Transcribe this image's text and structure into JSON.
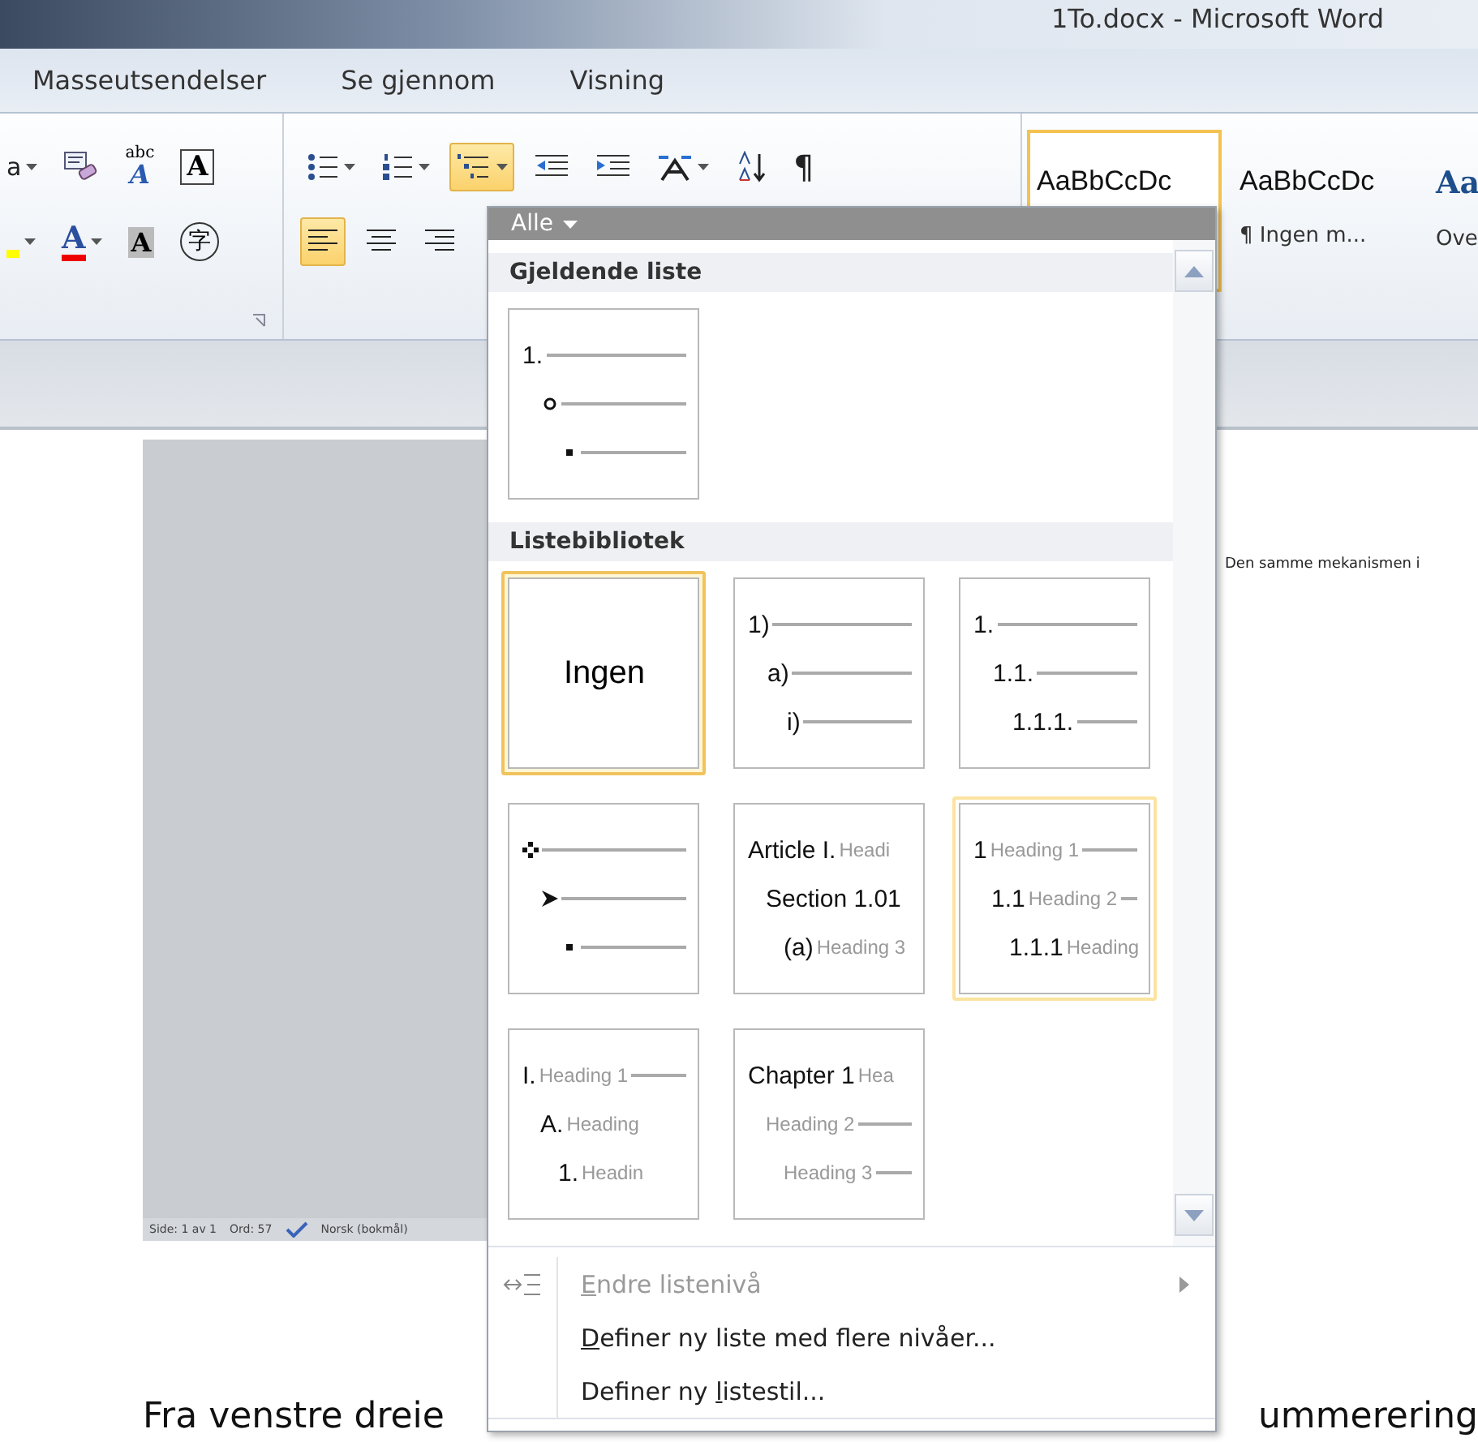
{
  "window": {
    "title": "1To.docx - Microsoft Word"
  },
  "tabs": [
    {
      "label": "Masseutsendelser",
      "selected": false
    },
    {
      "label": "Se gjennom",
      "selected": false
    },
    {
      "label": "Visning",
      "selected": false
    }
  ],
  "ribbon": {
    "font_row1": [
      {
        "kind": "text",
        "text": "a",
        "caret": true,
        "selected": false
      },
      {
        "kind": "eraser",
        "caret": false,
        "selected": false
      },
      {
        "kind": "phonetic",
        "text": "abc",
        "sub": "A",
        "caret": false,
        "selected": false
      },
      {
        "kind": "boxed",
        "text": "A",
        "caret": false,
        "selected": false
      }
    ],
    "font_row2": [
      {
        "kind": "highlight",
        "caret": true,
        "selected": false
      },
      {
        "kind": "fontcolor",
        "text": "A",
        "caret": true,
        "selected": false
      },
      {
        "kind": "shaded",
        "text": "A",
        "caret": false,
        "selected": false
      },
      {
        "kind": "enclosed",
        "text": "字",
        "caret": false,
        "selected": false
      }
    ],
    "para_row1": [
      {
        "kind": "bullets",
        "caret": true,
        "selected": false
      },
      {
        "kind": "numbering",
        "caret": true,
        "selected": false
      },
      {
        "kind": "multilevel",
        "caret": true,
        "selected": true
      },
      {
        "kind": "outdent",
        "caret": false,
        "selected": false
      },
      {
        "kind": "indent",
        "caret": false,
        "selected": false
      },
      {
        "kind": "asian",
        "caret": true,
        "selected": false
      },
      {
        "kind": "sort",
        "caret": false,
        "selected": false
      },
      {
        "kind": "pilcrow",
        "text": "¶",
        "caret": false,
        "selected": false
      }
    ],
    "para_row2": [
      {
        "kind": "left",
        "caret": false,
        "selected": true
      },
      {
        "kind": "center",
        "caret": false,
        "selected": false
      },
      {
        "kind": "right",
        "caret": false,
        "selected": false
      }
    ],
    "styles": [
      {
        "sample": "AaBbCcDc",
        "kind": "normal",
        "selected": true
      },
      {
        "sample": "AaBbCcDc",
        "name": "¶ Ingen m...",
        "kind": "normal",
        "selected": false
      },
      {
        "sample": "Aa",
        "name": "Ove",
        "kind": "heading",
        "selected": false
      }
    ]
  },
  "document": {
    "side_text": "Den samme mekanismen i",
    "body_left": "Fra venstre dreie",
    "body_right": "ummerering"
  },
  "status_bar": [
    "Side: 1 av 1",
    "Ord: 57",
    "Norsk (bokmål)"
  ],
  "dropdown": {
    "filter": "Alle",
    "sections": [
      {
        "title": "Gjeldende liste",
        "tiles": [
          {
            "kind": "list",
            "selected": false,
            "hover": false,
            "rows": [
              {
                "kind": "text",
                "marker": "1.",
                "line": true
              },
              {
                "kind": "circle",
                "line": true
              },
              {
                "kind": "square",
                "line": true
              }
            ]
          }
        ]
      },
      {
        "title": "Listebibliotek",
        "tiles": [
          {
            "kind": "none",
            "label": "Ingen",
            "selected": true,
            "hover": false
          },
          {
            "kind": "list",
            "selected": false,
            "hover": false,
            "rows": [
              {
                "kind": "text",
                "marker": "1)",
                "line": true
              },
              {
                "kind": "text",
                "marker": "a)",
                "line": true
              },
              {
                "kind": "text",
                "marker": "i)",
                "line": true
              }
            ]
          },
          {
            "kind": "list",
            "selected": false,
            "hover": false,
            "rows": [
              {
                "kind": "text",
                "marker": "1.",
                "line": true
              },
              {
                "kind": "text",
                "marker": "1.1.",
                "line": true
              },
              {
                "kind": "text",
                "marker": "1.1.1.",
                "line": true
              }
            ]
          },
          {
            "kind": "list",
            "selected": false,
            "hover": false,
            "rows": [
              {
                "kind": "diamond",
                "line": true
              },
              {
                "kind": "arrow",
                "line": true
              },
              {
                "kind": "square",
                "line": true
              }
            ]
          },
          {
            "kind": "list",
            "selected": false,
            "hover": false,
            "rows": [
              {
                "kind": "text",
                "marker": "Article I.",
                "label": "Headi"
              },
              {
                "kind": "text",
                "marker": "Section 1.01"
              },
              {
                "kind": "text",
                "marker": "(a)",
                "label": "Heading 3"
              }
            ]
          },
          {
            "kind": "list",
            "selected": false,
            "hover": true,
            "rows": [
              {
                "kind": "text",
                "marker": "1",
                "label": "Heading 1",
                "line": true
              },
              {
                "kind": "text",
                "marker": "1.1",
                "label": "Heading 2",
                "line": true
              },
              {
                "kind": "text",
                "marker": "1.1.1",
                "label": "Heading"
              }
            ]
          },
          {
            "kind": "list",
            "selected": false,
            "hover": false,
            "rows": [
              {
                "kind": "text",
                "marker": "I.",
                "label": "Heading 1",
                "line": true
              },
              {
                "kind": "text",
                "marker": "A.",
                "label": "Heading"
              },
              {
                "kind": "text",
                "marker": "1.",
                "label": "Headin"
              }
            ]
          },
          {
            "kind": "list",
            "selected": false,
            "hover": false,
            "rows": [
              {
                "kind": "text",
                "marker": "Chapter 1",
                "label": "Hea"
              },
              {
                "kind": "text",
                "label": "Heading 2",
                "line": true
              },
              {
                "kind": "text",
                "label": "Heading 3",
                "line": true
              }
            ]
          }
        ]
      }
    ],
    "menu": [
      {
        "label": "Endre listenivå",
        "disabled": true,
        "submenu": true,
        "icon": true
      },
      {
        "label": "Definer ny liste med flere nivåer...",
        "disabled": false,
        "submenu": false,
        "icon": false
      },
      {
        "label": "Definer ny listestil...",
        "disabled": false,
        "submenu": false,
        "icon": false
      }
    ]
  }
}
